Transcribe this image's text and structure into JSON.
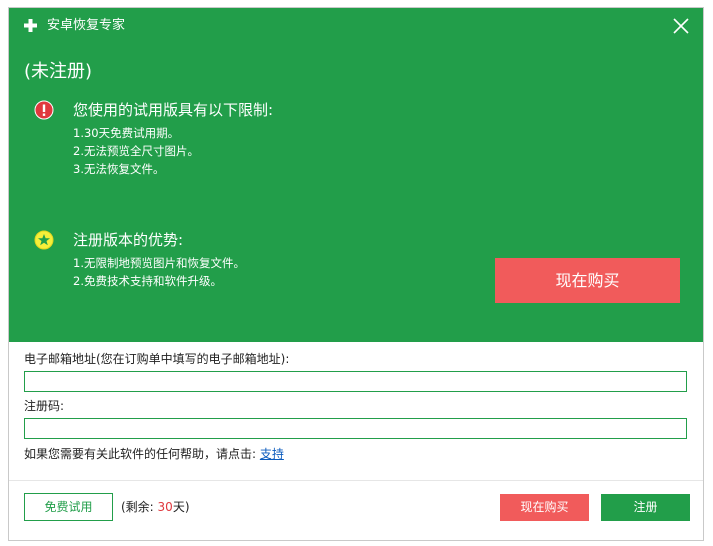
{
  "window": {
    "title": "安卓恢复专家"
  },
  "status": {
    "unregistered": "(未注册)"
  },
  "limits": {
    "title": "您使用的试用版具有以下限制:",
    "items": [
      "1.30天免费试用期。",
      "2.无法预览全尺寸图片。",
      "3.无法恢复文件。"
    ]
  },
  "advantages": {
    "title": "注册版本的优势:",
    "items": [
      "1.无限制地预览图片和恢复文件。",
      "2.免费技术支持和软件升级。"
    ]
  },
  "buy_now_big": "现在购买",
  "email": {
    "label": "电子邮箱地址(您在订购单中填写的电子邮箱地址):",
    "value": ""
  },
  "code": {
    "label": "注册码:",
    "value": ""
  },
  "help": {
    "text": "如果您需要有关此软件的任何帮助，请点击: ",
    "link": "支持"
  },
  "footer": {
    "trial_button": "免费试用",
    "remain_prefix": "(剩余: ",
    "remain_days": "30",
    "remain_suffix": "天)",
    "buy_button": "现在购买",
    "register_button": "注册"
  },
  "colors": {
    "brand_green": "#229e4a",
    "buy_red": "#f15b5b",
    "warning_red": "#e0383e",
    "star_yellow": "#f5ef3a",
    "link_blue": "#0b5bbd"
  },
  "icons": {
    "app": "plus-icon",
    "close": "close-icon",
    "warning": "exclamation-icon",
    "star": "star-icon"
  }
}
